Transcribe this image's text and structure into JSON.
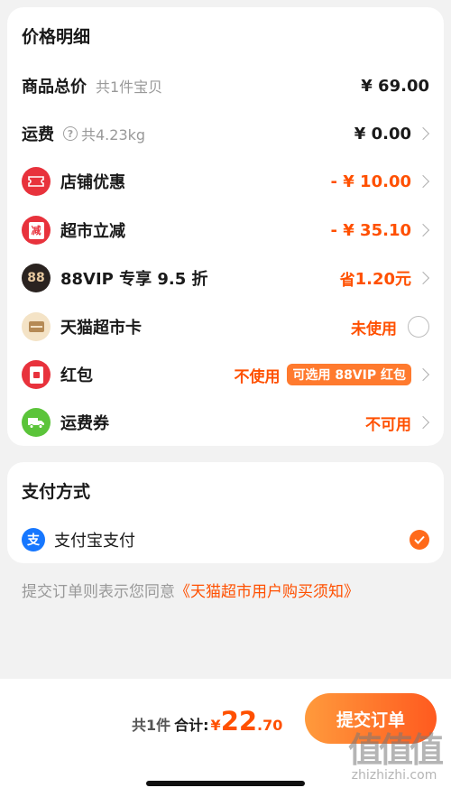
{
  "price_details": {
    "title": "价格明细",
    "subtotal": {
      "label": "商品总价",
      "sub": "共1件宝贝",
      "amount": "¥ 69.00"
    },
    "shipping": {
      "label": "运费",
      "weight": "共4.23kg",
      "amount": "¥ 0.00"
    },
    "store_discount": {
      "label": "店铺优惠",
      "amount": "- ¥ 10.00"
    },
    "market_discount": {
      "label": "超市立减",
      "amount": "- ¥ 35.10",
      "icon_text": "减"
    },
    "vip": {
      "label": "88VIP 专享 9.5 折",
      "prefix": "省",
      "amount": "1.20元",
      "icon_text": "88"
    },
    "tmall_card": {
      "label": "天猫超市卡",
      "status": "未使用"
    },
    "red_packet": {
      "label": "红包",
      "status": "不使用",
      "badge": "可选用 88VIP 红包"
    },
    "shipping_coupon": {
      "label": "运费券",
      "status": "不可用"
    }
  },
  "payment": {
    "title": "支付方式",
    "method": {
      "label": "支付宝支付",
      "icon_text": "支",
      "selected": true
    }
  },
  "agreement": {
    "prefix": "提交订单则表示您同意",
    "link": "《天猫超市用户购买须知》"
  },
  "footer": {
    "count": "共1件",
    "total_label": "合计:",
    "currency": "¥",
    "total_int": "22",
    "total_dec": ".70",
    "submit_label": "提交订单"
  },
  "watermark": {
    "big": "值值值",
    "small": "zhizhizhi.com"
  },
  "colors": {
    "accent": "#ff5000",
    "button_start": "#ff9a3c",
    "button_end": "#ff5a1f"
  },
  "icons": [
    "store-coupon-icon",
    "market-discount-icon",
    "vip-88-icon",
    "tmall-card-icon",
    "red-packet-icon",
    "truck-icon",
    "alipay-icon",
    "help-icon",
    "chevron-right-icon",
    "checkmark-icon"
  ]
}
